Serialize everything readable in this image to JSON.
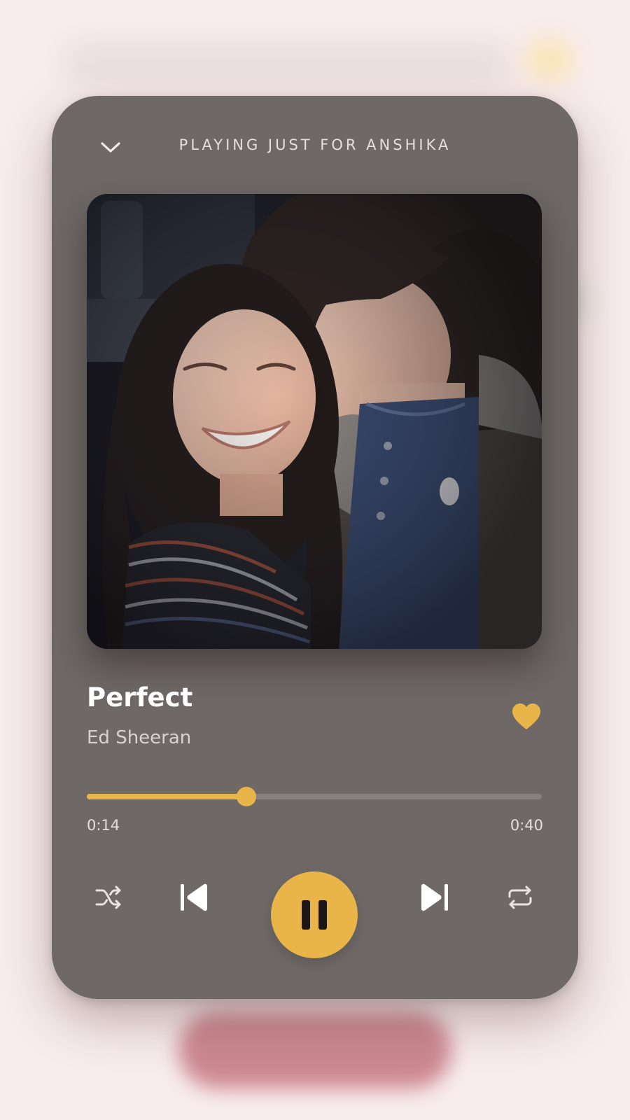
{
  "header": {
    "title": "PLAYING JUST FOR ANSHIKA",
    "collapse_icon": "chevron-down-icon"
  },
  "track": {
    "title": "Perfect",
    "artist": "Ed Sheeran",
    "liked": true
  },
  "progress": {
    "current_time": "0:14",
    "total_time": "0:40",
    "fraction": 0.35
  },
  "controls": {
    "shuffle_icon": "shuffle-icon",
    "previous_icon": "skip-previous-icon",
    "play_state": "playing",
    "play_icon": "pause-icon",
    "next_icon": "skip-next-icon",
    "repeat_icon": "repeat-icon"
  },
  "colors": {
    "accent": "#eab548",
    "card_background": "#6e6966",
    "page_background": "#f8ecec",
    "text_primary": "#ffffff",
    "text_secondary": "#d9d3d0"
  }
}
